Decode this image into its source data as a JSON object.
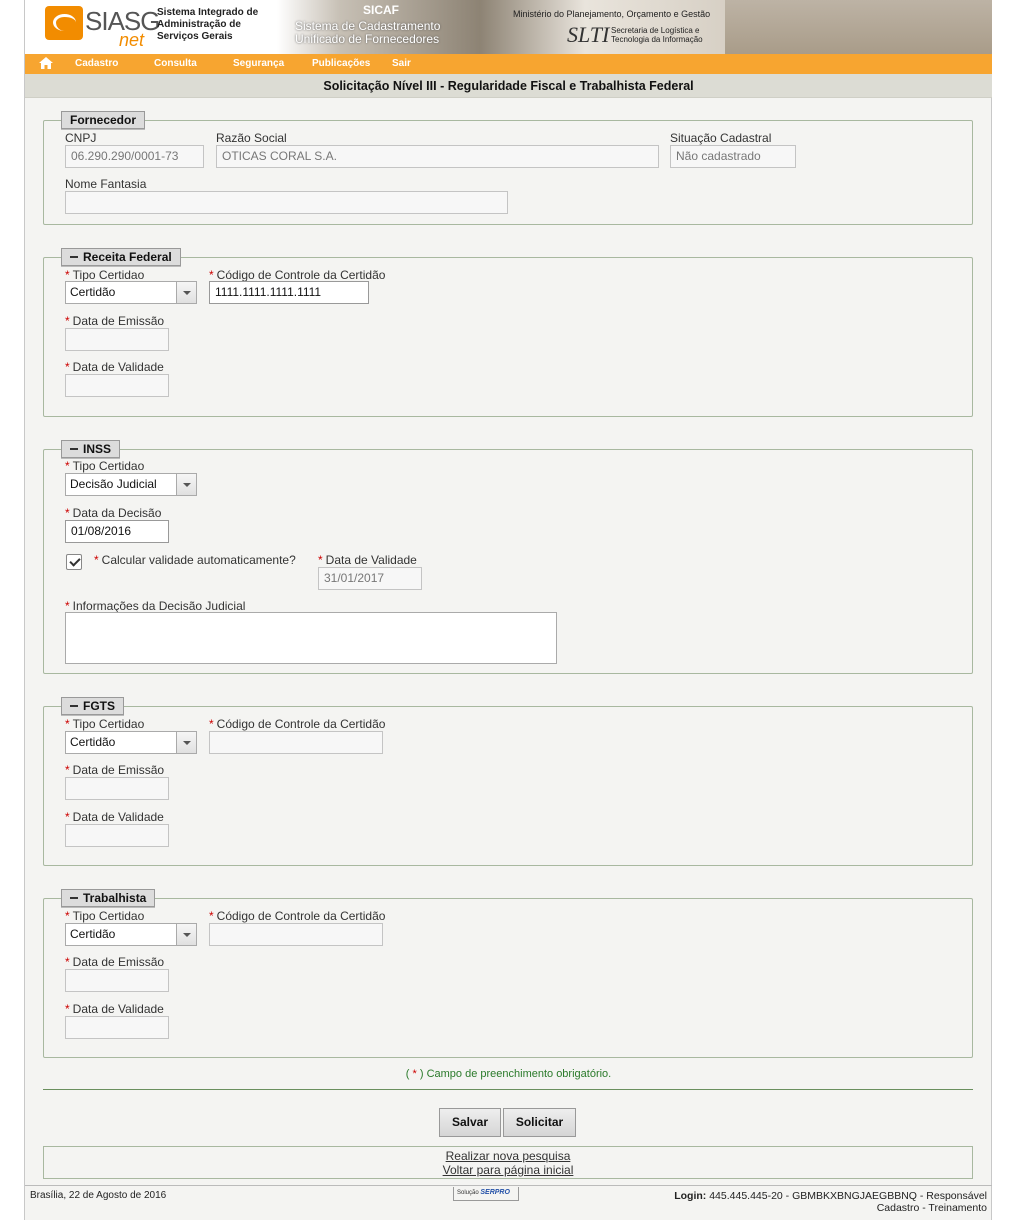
{
  "banner": {
    "logo_main": "SIASG",
    "logo_sub": "net",
    "system_name": [
      "Sistema Integrado de",
      "Administração de",
      "Serviços Gerais"
    ],
    "sicaf": "SICAF",
    "sicaf_full": [
      "Sistema de Cadastramento",
      "Unificado de Fornecedores"
    ],
    "ministry": "Ministério do Planejamento, Orçamento e Gestão",
    "slti": "SLTI",
    "slti_sub": [
      "Secretaria de Logística e",
      "Tecnologia da Informação"
    ]
  },
  "menu": {
    "home_icon": "home-icon",
    "items": [
      "Cadastro",
      "Consulta",
      "Segurança",
      "Publicações",
      "Sair"
    ]
  },
  "page_title": "Solicitação Nível III - Regularidade Fiscal e Trabalhista Federal",
  "fornecedor": {
    "legend": "Fornecedor",
    "cnpj_label": "CNPJ",
    "cnpj_value": "06.290.290/0001-73",
    "razao_label": "Razão Social",
    "razao_value": "OTICAS CORAL S.A.",
    "situacao_label": "Situação Cadastral",
    "situacao_value": "Não cadastrado",
    "fantasia_label": "Nome Fantasia",
    "fantasia_value": ""
  },
  "receita": {
    "legend": "Receita Federal",
    "tipo_label": "Tipo Certidao",
    "tipo_value": "Certidão",
    "codigo_label": "Código de Controle da Certidão",
    "codigo_value": "1111.1111.1111.1111",
    "emissao_label": "Data de Emissão",
    "validade_label": "Data de Validade"
  },
  "inss": {
    "legend": "INSS",
    "tipo_label": "Tipo Certidao",
    "tipo_value": "Decisão Judicial",
    "decisao_label": "Data da Decisão",
    "decisao_value": "01/08/2016",
    "calc_label": "Calcular validade automaticamente?",
    "calc_checked": true,
    "validade_label": "Data de Validade",
    "validade_value": "31/01/2017",
    "info_label": "Informações da Decisão Judicial"
  },
  "fgts": {
    "legend": "FGTS",
    "tipo_label": "Tipo Certidao",
    "tipo_value": "Certidão",
    "codigo_label": "Código de Controle da Certidão",
    "emissao_label": "Data de Emissão",
    "validade_label": "Data de Validade"
  },
  "trabalhista": {
    "legend": "Trabalhista",
    "tipo_label": "Tipo Certidao",
    "tipo_value": "Certidão",
    "codigo_label": "Código de Controle da Certidão",
    "emissao_label": "Data de Emissão",
    "validade_label": "Data de Validade"
  },
  "required_marker": "*",
  "required_note": {
    "open": "(",
    "star": " * ",
    "text": ") Campo de preenchimento obrigatório."
  },
  "buttons": {
    "save": "Salvar",
    "request": "Solicitar"
  },
  "links": {
    "new_search": "Realizar nova pesquisa",
    "home": "Voltar para página inicial"
  },
  "footer": {
    "date": "Brasília, 22 de Agosto de 2016",
    "serpro_prefix": "Solução",
    "serpro": "SERPRO",
    "login_label": "Login:",
    "login_value": "445.445.445-20 - GBMBKXBNGJAEGBBNQ - Responsável",
    "login_line2": "Cadastro - Treinamento"
  }
}
